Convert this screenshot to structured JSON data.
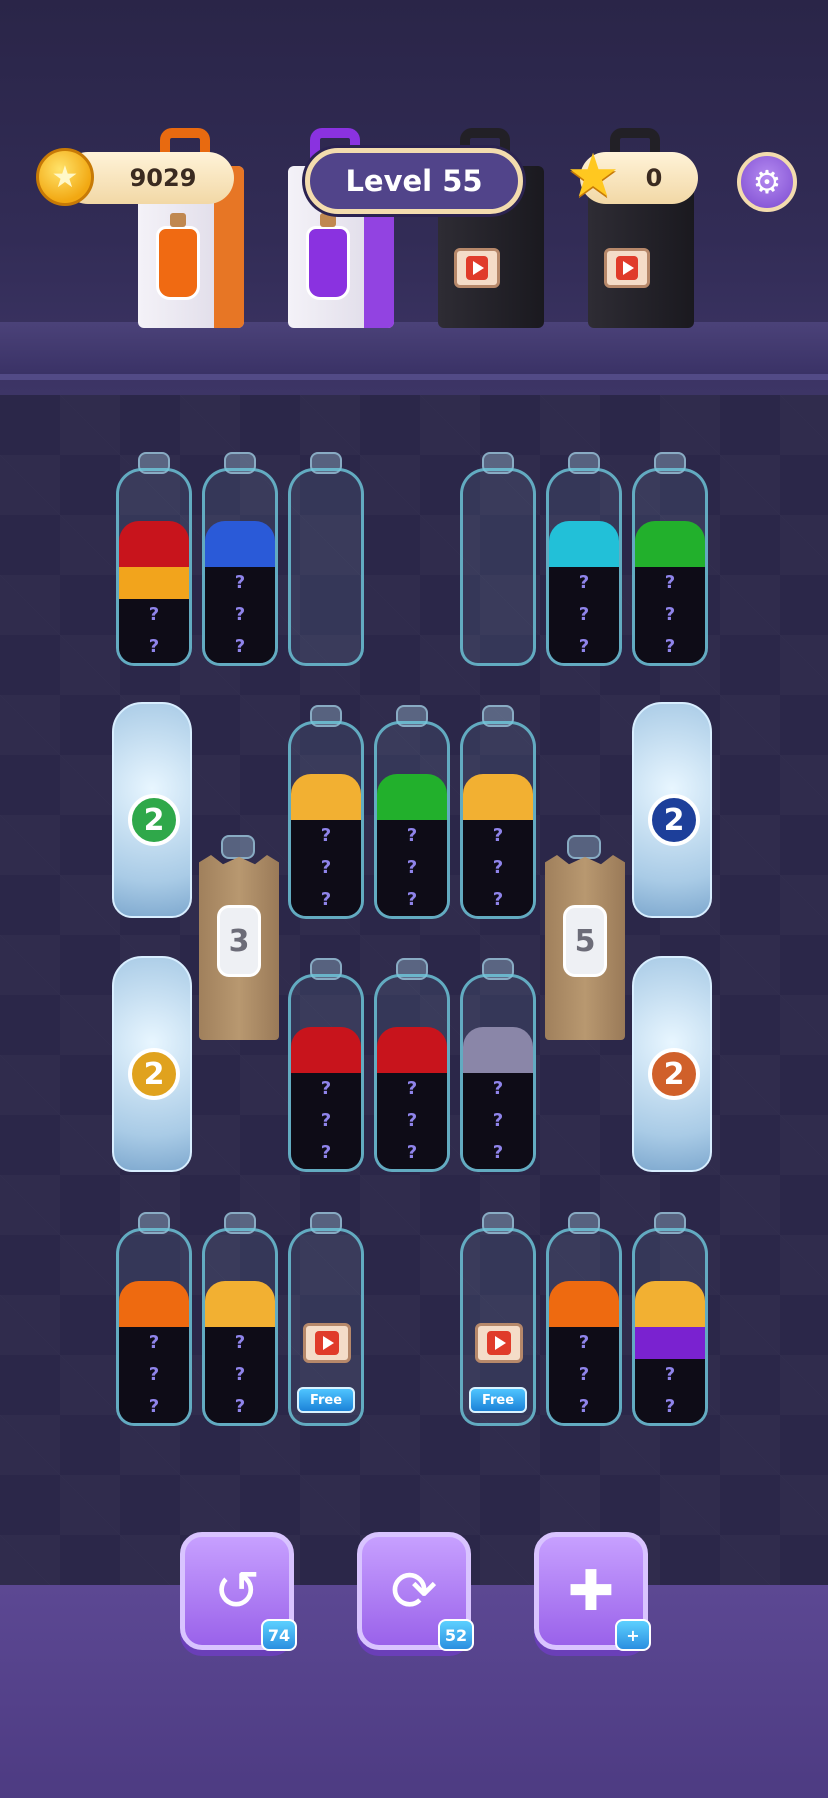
{
  "header": {
    "coins": "9029",
    "level": "Level 55",
    "stars": "0"
  },
  "icons": {
    "coin": "star-coin-icon",
    "star": "star-icon",
    "settings": "gear-icon"
  },
  "bags": [
    {
      "type": "bottle",
      "color": "#f06a12"
    },
    {
      "type": "bottle",
      "color": "#8a32e0"
    },
    {
      "type": "video"
    },
    {
      "type": "video"
    }
  ],
  "tubes": {
    "row1": [
      {
        "layers": [
          "red",
          "orange-yellow",
          "hidden",
          "hidden"
        ]
      },
      {
        "layers": [
          "blue",
          "hidden",
          "hidden",
          "hidden"
        ]
      },
      {
        "layers": []
      },
      {
        "layers": []
      },
      {
        "layers": [
          "cyan",
          "hidden",
          "hidden",
          "hidden"
        ]
      },
      {
        "layers": [
          "green",
          "hidden",
          "hidden",
          "hidden"
        ]
      }
    ],
    "row2": [
      {
        "layers": [
          "yellow",
          "hidden",
          "hidden",
          "hidden"
        ]
      },
      {
        "layers": [
          "green",
          "hidden",
          "hidden",
          "hidden"
        ]
      },
      {
        "layers": [
          "yellow",
          "hidden",
          "hidden",
          "hidden"
        ]
      }
    ],
    "row3": [
      {
        "layers": [
          "red",
          "hidden",
          "hidden",
          "hidden"
        ]
      },
      {
        "layers": [
          "red",
          "hidden",
          "hidden",
          "hidden"
        ]
      },
      {
        "layers": [
          "gray",
          "hidden",
          "hidden",
          "hidden"
        ]
      }
    ],
    "row4": [
      {
        "layers": [
          "orange",
          "hidden",
          "hidden",
          "hidden"
        ]
      },
      {
        "layers": [
          "yellow",
          "hidden",
          "hidden",
          "hidden"
        ]
      },
      {
        "locked": true,
        "free_label": "Free"
      },
      {
        "locked": true,
        "free_label": "Free"
      },
      {
        "layers": [
          "orange",
          "hidden",
          "hidden",
          "hidden"
        ]
      },
      {
        "layers": [
          "yellow",
          "purple",
          "hidden",
          "hidden"
        ]
      }
    ]
  },
  "frozen_tubes": [
    {
      "count": "2",
      "badge_color": "#2fa84a"
    },
    {
      "count": "2",
      "badge_color": "#1d3f9a"
    },
    {
      "count": "2",
      "badge_color": "#e0a21e"
    },
    {
      "count": "2",
      "badge_color": "#d0602a"
    }
  ],
  "sacks": [
    {
      "count": "3"
    },
    {
      "count": "5"
    }
  ],
  "hidden_marker": "?",
  "layer_colors": {
    "red": "#c8141c",
    "orange-yellow": "#f2a41c",
    "blue": "#2a5ad8",
    "cyan": "#22c0d8",
    "green": "#22b02c",
    "yellow": "#f2b032",
    "gray": "#8a86a8",
    "orange": "#ee6a10",
    "purple": "#7a22d0"
  },
  "tools": [
    {
      "name": "undo",
      "count": "74"
    },
    {
      "name": "shuffle",
      "count": "52"
    },
    {
      "name": "add-tube",
      "count": "+"
    }
  ]
}
